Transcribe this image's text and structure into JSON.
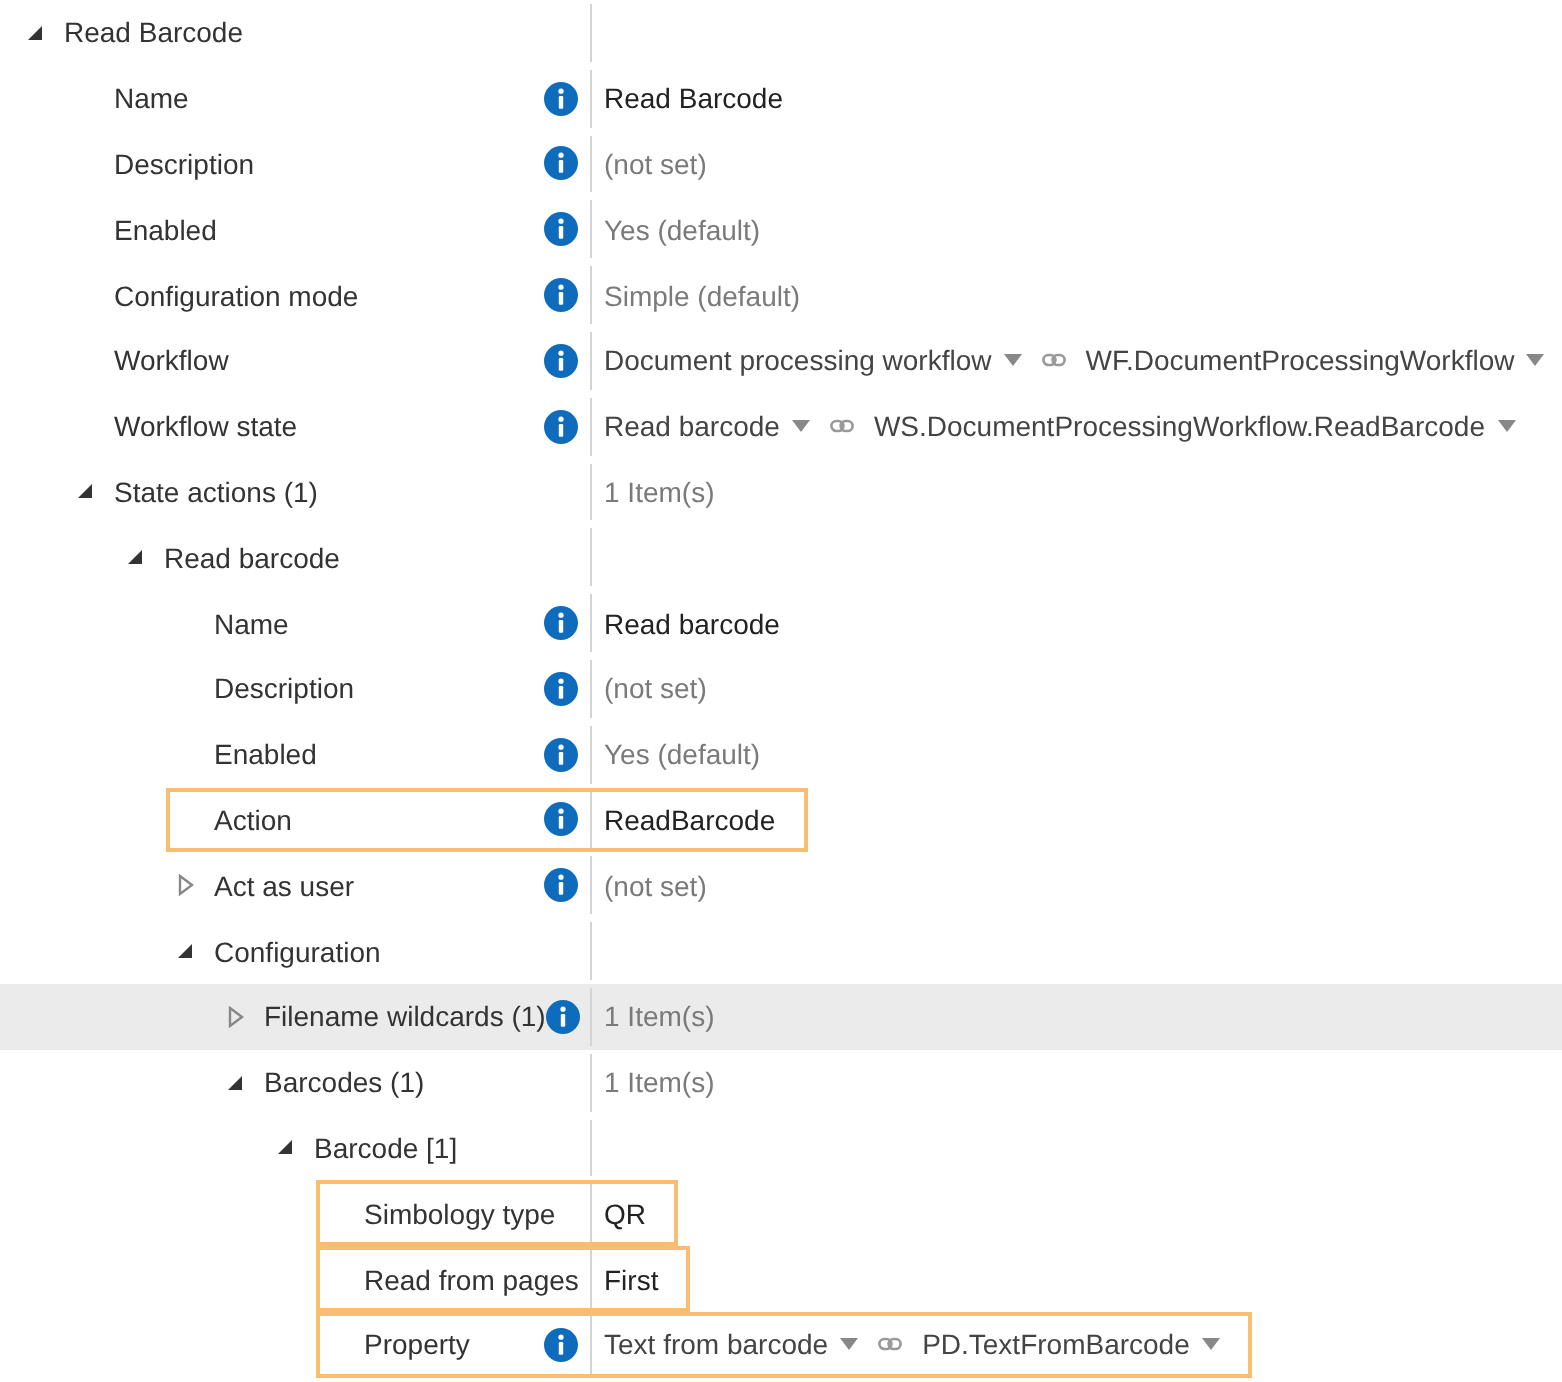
{
  "tree": [
    {
      "label": "Read Barcode",
      "expanded": true,
      "info": false,
      "selected": false,
      "highlighted": false,
      "children": [
        {
          "label": "Name",
          "info": true,
          "selected": false,
          "highlighted": false,
          "value": {
            "kind": "text",
            "text": "Read Barcode"
          }
        },
        {
          "label": "Description",
          "info": true,
          "selected": false,
          "highlighted": false,
          "value": {
            "kind": "muted",
            "text": "(not set)"
          }
        },
        {
          "label": "Enabled",
          "info": true,
          "selected": false,
          "highlighted": false,
          "value": {
            "kind": "muted",
            "text": "Yes (default)"
          }
        },
        {
          "label": "Configuration mode",
          "info": true,
          "selected": false,
          "highlighted": false,
          "value": {
            "kind": "muted",
            "text": "Simple (default)"
          }
        },
        {
          "label": "Workflow",
          "info": true,
          "selected": false,
          "highlighted": false,
          "value": {
            "kind": "binding",
            "text": "Document processing workflow",
            "reference": "WF.DocumentProcessingWorkflow"
          }
        },
        {
          "label": "Workflow state",
          "info": true,
          "selected": false,
          "highlighted": false,
          "value": {
            "kind": "binding",
            "text": "Read barcode",
            "reference": "WS.DocumentProcessingWorkflow.ReadBarcode"
          }
        },
        {
          "label": "State actions (1)",
          "expanded": true,
          "info": false,
          "selected": false,
          "highlighted": false,
          "value": {
            "kind": "muted",
            "text": "1 Item(s)"
          },
          "children": [
            {
              "label": "Read barcode",
              "expanded": true,
              "info": false,
              "selected": false,
              "highlighted": false,
              "children": [
                {
                  "label": "Name",
                  "info": true,
                  "selected": false,
                  "highlighted": false,
                  "value": {
                    "kind": "text",
                    "text": "Read barcode"
                  }
                },
                {
                  "label": "Description",
                  "info": true,
                  "selected": false,
                  "highlighted": false,
                  "value": {
                    "kind": "muted",
                    "text": "(not set)"
                  }
                },
                {
                  "label": "Enabled",
                  "info": true,
                  "selected": false,
                  "highlighted": false,
                  "value": {
                    "kind": "muted",
                    "text": "Yes (default)"
                  }
                },
                {
                  "label": "Action",
                  "info": true,
                  "selected": false,
                  "highlighted": true,
                  "value": {
                    "kind": "text",
                    "text": "ReadBarcode"
                  }
                },
                {
                  "label": "Act as user",
                  "expanded": false,
                  "info": true,
                  "selected": false,
                  "highlighted": false,
                  "value": {
                    "kind": "muted",
                    "text": "(not set)"
                  }
                },
                {
                  "label": "Configuration",
                  "expanded": true,
                  "info": false,
                  "selected": false,
                  "highlighted": false,
                  "children": [
                    {
                      "label": "Filename wildcards (1)",
                      "expanded": false,
                      "info": true,
                      "selected": true,
                      "highlighted": false,
                      "value": {
                        "kind": "muted",
                        "text": "1 Item(s)"
                      }
                    },
                    {
                      "label": "Barcodes (1)",
                      "expanded": true,
                      "info": false,
                      "selected": false,
                      "highlighted": false,
                      "value": {
                        "kind": "muted",
                        "text": "1 Item(s)"
                      },
                      "children": [
                        {
                          "label": "Barcode [1]",
                          "expanded": true,
                          "info": false,
                          "selected": false,
                          "highlighted": false,
                          "children": [
                            {
                              "label": "Simbology type",
                              "info": false,
                              "selected": false,
                              "highlighted": true,
                              "value": {
                                "kind": "text",
                                "text": "QR"
                              }
                            },
                            {
                              "label": "Read from pages",
                              "info": false,
                              "selected": false,
                              "highlighted": true,
                              "value": {
                                "kind": "text",
                                "text": "First"
                              }
                            },
                            {
                              "label": "Property",
                              "info": true,
                              "selected": false,
                              "highlighted": true,
                              "value": {
                                "kind": "binding",
                                "text": "Text from barcode",
                                "reference": "PD.TextFromBarcode"
                              }
                            }
                          ]
                        }
                      ]
                    }
                  ]
                }
              ]
            }
          ]
        }
      ]
    }
  ]
}
